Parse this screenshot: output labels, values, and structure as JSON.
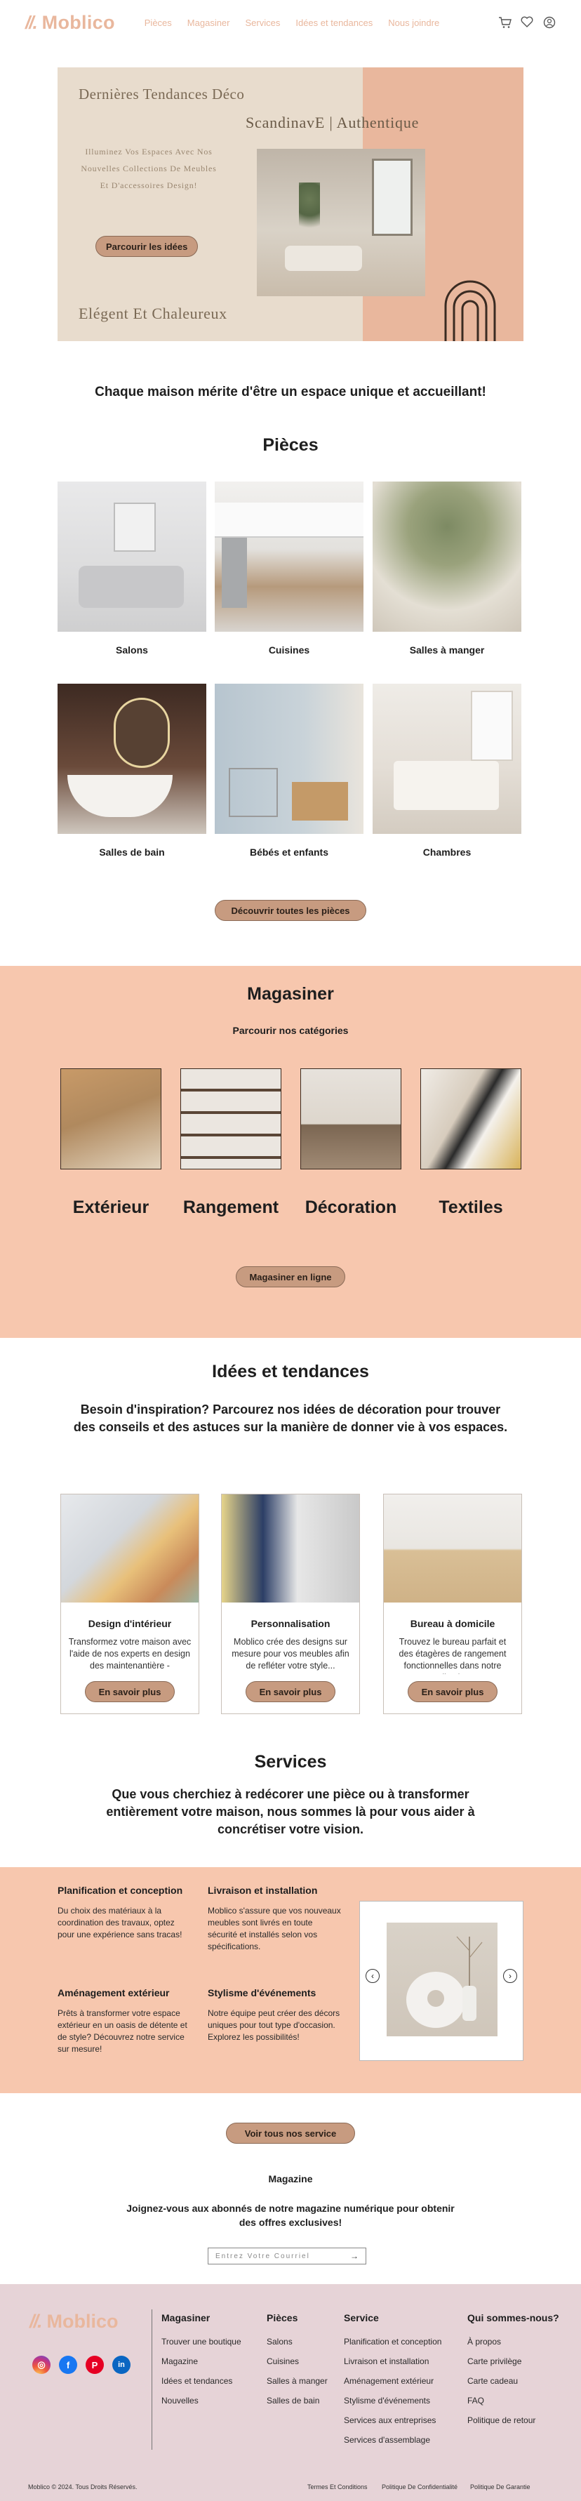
{
  "header": {
    "logo_mark": "//.",
    "logo_text": "Moblico",
    "nav": [
      "Pièces",
      "Magasiner",
      "Services",
      "Idées et tendances",
      "Nous joindre"
    ]
  },
  "hero": {
    "title": "Dernières Tendances Déco",
    "subtitle": "ScandinavE | Authentique",
    "body": "Illuminez Vos Espaces Avec Nos Nouvelles Collections De Meubles Et D'accessoires Design!",
    "button": "Parcourir les idées",
    "footer": "Elégent Et Chaleureux"
  },
  "tagline": "Chaque maison mérite d'être un espace unique et accueillant!",
  "rooms": {
    "title": "Pièces",
    "items": [
      "Salons",
      "Cuisines",
      "Salles à manger",
      "Salles de bain",
      "Bébés et enfants",
      "Chambres"
    ],
    "button": "Découvrir toutes les pièces"
  },
  "shop": {
    "title": "Magasiner",
    "subtitle": "Parcourir nos catégories",
    "categories": [
      "Extérieur",
      "Rangement",
      "Décoration",
      "Textiles"
    ],
    "button": "Magasiner en ligne"
  },
  "ideas": {
    "title": "Idées et tendances",
    "intro": "Besoin d'inspiration? Parcourez nos idées de décoration pour trouver des conseils et des astuces sur la manière de donner vie à vos espaces.",
    "cards": [
      {
        "title": "Design d'intérieur",
        "body": "Transformez votre maison avec l'aide de nos experts en design des maintenantière -",
        "button": "En savoir plus"
      },
      {
        "title": "Personnalisation",
        "body": "Moblico crée des designs sur mesure pour vos meubles afin de refléter votre style...",
        "button": "En savoir plus"
      },
      {
        "title": "Bureau à domicile",
        "body": "Trouvez le bureau parfait et des étagères de rangement fonctionnelles dans notre collection.",
        "button": "En savoir plus"
      }
    ]
  },
  "services": {
    "title": "Services",
    "intro": "Que vous cherchiez à redécorer une pièce ou à transformer entièrement votre maison, nous sommes là pour vous aider à concrétiser votre vision.",
    "items": [
      {
        "title": "Planification et conception",
        "body": "Du choix des matériaux à la coordination des travaux, optez pour une expérience sans tracas!"
      },
      {
        "title": "Livraison et installation",
        "body": "Moblico s'assure que vos nouveaux meubles sont livrés en toute sécurité et installés selon vos spécifications."
      },
      {
        "title": "Aménagement extérieur",
        "body": "Prêts à transformer votre espace extérieur en un oasis de détente et de style? Découvrez notre service sur mesure!"
      },
      {
        "title": "Stylisme d'événements",
        "body": "Notre équipe peut créer des décors uniques pour tout type d'occasion. Explorez les possibilités!"
      }
    ],
    "button": "Voir tous nos service"
  },
  "newsletter": {
    "title": "Magazine",
    "body": "Joignez-vous aux abonnés de notre magazine numérique pour obtenir des offres exclusives!",
    "placeholder": "Entrez Votre Courriel"
  },
  "footer": {
    "columns": [
      {
        "title": "Magasiner",
        "links": [
          "Trouver une boutique",
          "Magazine",
          "Idées et tendances",
          "Nouvelles"
        ]
      },
      {
        "title": "Pièces",
        "links": [
          "Salons",
          "Cuisines",
          "Salles à manger",
          "Salles de bain"
        ]
      },
      {
        "title": "Service",
        "links": [
          "Planification et conception",
          "Livraison et installation",
          "Aménagement extérieur",
          "Stylisme d'événements",
          "Services aux entreprises",
          "Services d'assemblage"
        ]
      },
      {
        "title": "Qui sommes-nous?",
        "links": [
          "À propos",
          "Carte privilège",
          "Carte cadeau",
          "FAQ",
          "Politique de retour"
        ]
      }
    ],
    "copyright": "Moblico © 2024. Tous Droits Réservés.",
    "legal": [
      "Termes Et Conditions",
      "Politique De Confidentialité",
      "Politique De Garantie"
    ],
    "social_icons": [
      "instagram-icon",
      "facebook-icon",
      "pinterest-icon",
      "linkedin-icon"
    ],
    "social_labels": [
      "◎",
      "f",
      "P",
      "in"
    ]
  },
  "colors": {
    "accent": "#e9b79d",
    "peach": "#f7c7ae",
    "button": "#c79b80",
    "beige": "#e8dccd",
    "footer": "#e6d3d7"
  }
}
